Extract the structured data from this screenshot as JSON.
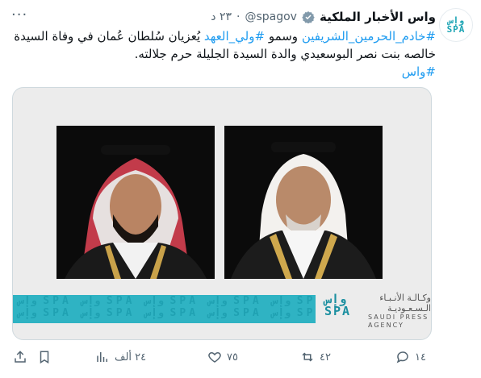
{
  "account": {
    "name": "واس الأخبار الملكية",
    "handle": "@spagov",
    "separator": "·",
    "time": "٢٣ د",
    "avatar_logo_line1": "وإس",
    "avatar_logo_line2": "SPA"
  },
  "more_icon": "···",
  "tweet": {
    "hashtag1": "#خادم_الحرمين_الشريفين",
    "text1": " وسمو ",
    "hashtag2": "#ولي_العهد",
    "text2": " يُعزيان سُلطان عُمان في وفاة السيدة خالصه بنت نصر البوسعيدي والدة السيدة الجليلة حرم جلالته.",
    "hashtag3": "#واس"
  },
  "media": {
    "strip_text": "وإس SPA وإس SPA وإس SPA وإس SPA وإس SPA وإس SPA وإس SPA وإس SPA",
    "brand_mark_line1": "وإس",
    "brand_mark_line2": "SPA",
    "agency_ar_line1": "وكـالـة الأنـبـاء",
    "agency_ar_line2": "الـسـعـوديـة",
    "agency_en_line1": "SAUDI PRESS",
    "agency_en_line2": "AGENCY"
  },
  "actions": {
    "replies": "١٤",
    "reposts": "٤٢",
    "likes": "٧٥",
    "views": "٢٤ ألف"
  },
  "colors": {
    "accent": "#1d9bf0",
    "muted": "#536471",
    "brand_teal": "#2fb3c3"
  }
}
